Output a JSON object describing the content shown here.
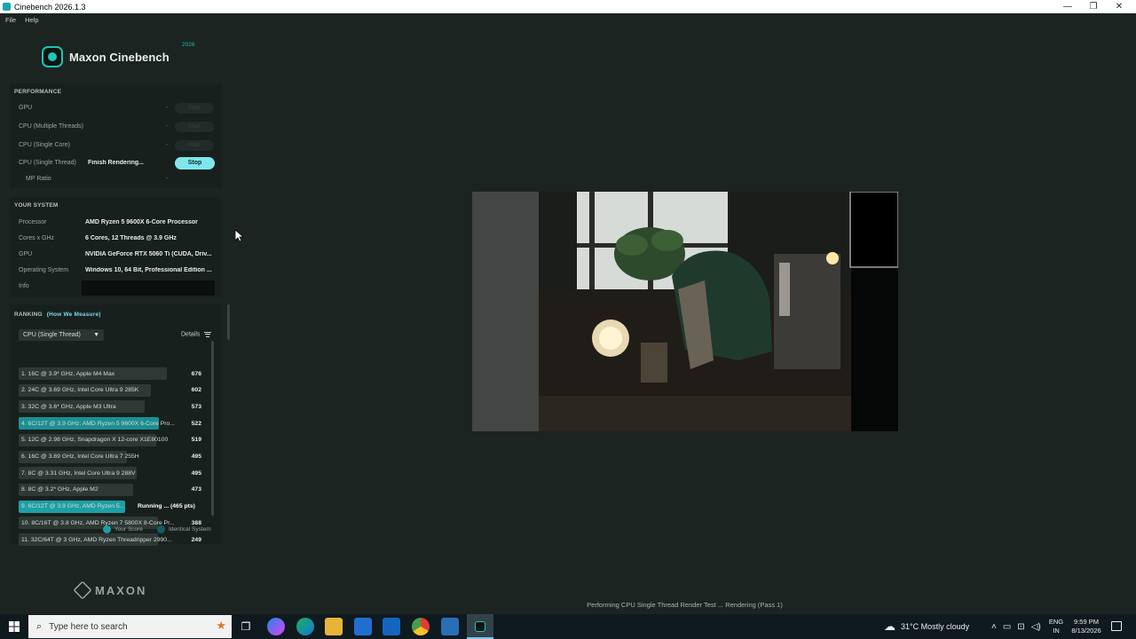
{
  "window": {
    "title": "Cinebench 2026.1.3",
    "minimize": "—",
    "maximize": "❐",
    "close": "✕"
  },
  "menu": [
    "File",
    "Help"
  ],
  "brand": {
    "name": "Maxon Cinebench",
    "year": "2026",
    "footer": "MAXON"
  },
  "performance": {
    "title": "PERFORMANCE",
    "rows": [
      {
        "label": "GPU",
        "value": "-",
        "button": "Start"
      },
      {
        "label": "CPU (Multiple Threads)",
        "value": "-",
        "button": "Start"
      },
      {
        "label": "CPU (Single Core)",
        "value": "-",
        "button": "Start"
      },
      {
        "label": "CPU (Single Thread)",
        "value": "Finish Rendering...",
        "button": "Stop"
      },
      {
        "label": "MP Ratio",
        "value": "-"
      }
    ]
  },
  "system": {
    "title": "YOUR SYSTEM",
    "rows": [
      {
        "label": "Processor",
        "value": "AMD Ryzen 5 9600X 6-Core Processor"
      },
      {
        "label": "Cores x GHz",
        "value": "6 Cores, 12 Threads @ 3.9 GHz"
      },
      {
        "label": "GPU",
        "value": "NVIDIA GeForce RTX 5060 Ti (CUDA, Driv..."
      },
      {
        "label": "Operating System",
        "value": "Windows 10, 64 Bit, Professional Edition ..."
      },
      {
        "label": "Info",
        "value": ""
      }
    ]
  },
  "ranking": {
    "title": "RANKING",
    "link": "(How We Measure)",
    "select": "CPU (Single Thread)",
    "details": "Details",
    "rows": [
      {
        "text": "1. 16C @ 3.9* GHz, Apple M4 Max",
        "score": "676",
        "fill": 0.92,
        "kind": "other"
      },
      {
        "text": "2. 24C @ 3.69 GHz, Intel Core Ultra 9 285K",
        "score": "602",
        "fill": 0.82,
        "kind": "other"
      },
      {
        "text": "3. 32C @ 3.6* GHz, Apple M3 Ultra",
        "score": "573",
        "fill": 0.78,
        "kind": "other"
      },
      {
        "text": "4. 6C/12T @ 3.9 GHz, AMD Ryzen 5 9600X 6-Core Pro...",
        "score": "522",
        "fill": 0.87,
        "kind": "identical"
      },
      {
        "text": "5. 12C @ 2.98 GHz, Snapdragon X 12-core X1E80100",
        "score": "519",
        "fill": 0.85,
        "kind": "other"
      },
      {
        "text": "6. 16C @ 3.69 GHz, Intel Core Ultra 7 255H",
        "score": "495",
        "fill": 0.67,
        "kind": "other"
      },
      {
        "text": "7. 8C @ 3.31 GHz, Intel Core Ultra 9 288V",
        "score": "495",
        "fill": 0.73,
        "kind": "other"
      },
      {
        "text": "8. 8C @ 3.2* GHz, Apple M2",
        "score": "473",
        "fill": 0.71,
        "kind": "other"
      },
      {
        "text": "9. 6C/12T @ 3.9 GHz, AMD Ryzen 5...",
        "score": "",
        "running": "Running ... (465 pts)",
        "fill": 0.66,
        "kind": "yours"
      },
      {
        "text": "10. 8C/16T @ 3.8 GHz, AMD Ryzen 7 5800X 8-Core Pr...",
        "score": "388",
        "fill": 0.86,
        "kind": "other"
      },
      {
        "text": "11. 32C/64T @ 3 GHz, AMD Ryzen Threadripper 2990...",
        "score": "249",
        "fill": 0.86,
        "kind": "other"
      }
    ],
    "legend": {
      "yours": "Your Score",
      "identical": "Identical System"
    }
  },
  "status": "Performing CPU Single Thread Render Test ... Rendering (Pass 1)",
  "taskbar": {
    "search_placeholder": "Type here to search",
    "weather": "31°C  Mostly cloudy",
    "lang1": "ENG",
    "lang2": "IN",
    "time": "9:59 PM",
    "date": "8/13/2026"
  },
  "colors": {
    "accent": "#1ec5b6",
    "stop": "#7fe6ec",
    "yours": "#1d9fa6",
    "identical": "#1d8f93"
  }
}
